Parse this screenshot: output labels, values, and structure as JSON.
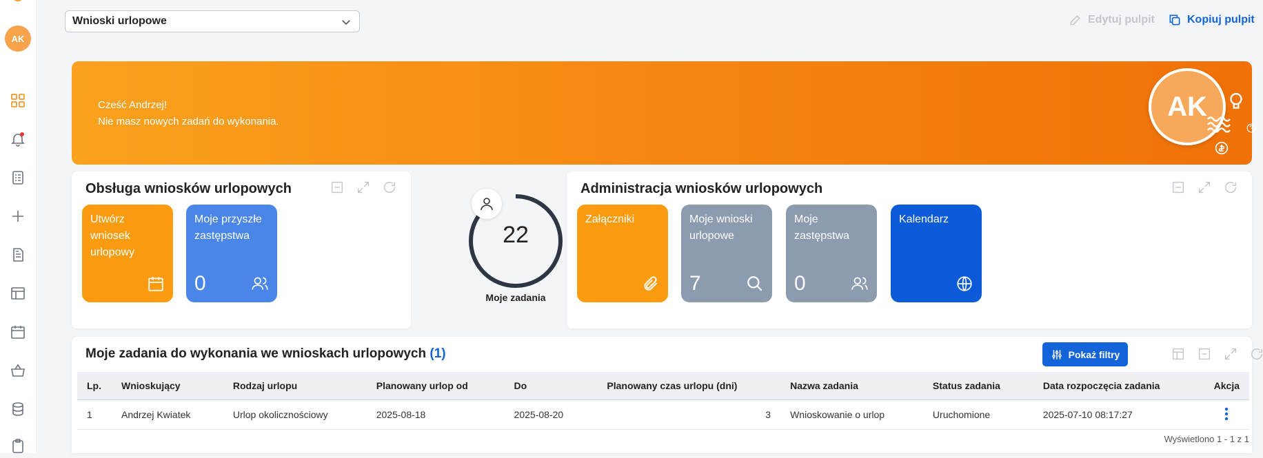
{
  "sidebar": {
    "avatar_initials": "AK",
    "icons": [
      "dashboard-icon",
      "bell-icon",
      "task-list-icon",
      "plus-icon",
      "document-icon",
      "layout-icon",
      "calendar-icon",
      "basket-icon",
      "database-icon",
      "clipboard-icon"
    ]
  },
  "header": {
    "dashboard_select": "Wnioski urlopowe",
    "edit_label": "Edytuj pulpit",
    "copy_label": "Kopiuj pulpit"
  },
  "banner": {
    "greeting": "Cześć Andrzej!",
    "message": "Nie masz nowych zadań do wykonania.",
    "avatar_initials": "AK"
  },
  "service_card": {
    "title": "Obsługa wniosków urlopowych",
    "tiles": [
      {
        "label": "Utwórz wniosek urlopowy",
        "color": "#fb9b10",
        "icon": "calendar-icon"
      },
      {
        "label": "Moje przyszłe zastępstwa",
        "value": "0",
        "color": "#4a86e8",
        "icon": "users-icon"
      }
    ]
  },
  "tasks_gauge": {
    "value": "22",
    "label": "Moje zadania"
  },
  "admin_card": {
    "title": "Administracja wniosków urlopowych",
    "tiles": [
      {
        "label": "Załączniki",
        "color": "#fb9b10",
        "icon": "paperclip-icon"
      },
      {
        "label": "Moje wnioski urlopowe",
        "value": "7",
        "color": "#8d9bb1",
        "icon": "search-icon"
      },
      {
        "label": "Moje zastępstwa",
        "value": "0",
        "color": "#8d9bb1",
        "icon": "users-icon"
      },
      {
        "label": "Kalendarz",
        "color": "#0b5bd8",
        "icon": "globe-icon"
      }
    ]
  },
  "tasks_table": {
    "title": "Moje zadania do wykonania we wnioskach urlopowych",
    "count": "(1)",
    "filters_button": "Pokaż filtry",
    "columns": [
      "Lp.",
      "Wnioskujący",
      "Rodzaj urlopu",
      "Planowany urlop od",
      "Do",
      "Planowany czas urlopu (dni)",
      "Nazwa zadania",
      "Status zadania",
      "Data rozpoczęcia zadania",
      "Akcja"
    ],
    "rows": [
      [
        "1",
        "Andrzej Kwiatek",
        "Urlop okolicznościowy",
        "2025-08-18",
        "2025-08-20",
        "3",
        "Wnioskowanie o urlop",
        "Uruchomione",
        "2025-07-10 08:17:27"
      ]
    ],
    "footer": "Wyświetlono 1 - 1 z 1"
  },
  "colors": {
    "accent": "#f39a2b",
    "primary": "#1264d8",
    "muted": "#c3c7cd"
  }
}
